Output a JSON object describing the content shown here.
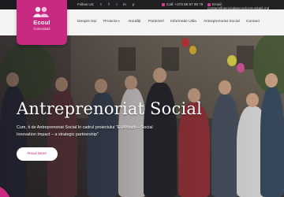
{
  "topbar": {
    "follow_label": "Follow Us:",
    "social_icons": [
      "twitter-icon",
      "facebook-icon",
      "instagram-icon",
      "linkedin-icon",
      "youtube-icon"
    ],
    "social_glyphs": [
      "t",
      "f",
      "i",
      "in",
      "y"
    ],
    "call": "Call: +373 68 57 08 79",
    "email": "Email: contact@asociatiaecoulcomunitatii.md"
  },
  "logo": {
    "line1": "Ecoul",
    "line2": "Comunitatii"
  },
  "nav": {
    "items": [
      {
        "label": "Despre Noi",
        "has_caret": false
      },
      {
        "label": "Proiecte",
        "has_caret": true
      },
      {
        "label": "Noutăți",
        "has_caret": false
      },
      {
        "label": "Parteneri",
        "has_caret": false
      },
      {
        "label": "Informatie Utila",
        "has_caret": false
      },
      {
        "label": "Antreprenoriat Social",
        "has_caret": false
      },
      {
        "label": "Contact",
        "has_caret": false
      }
    ]
  },
  "hero": {
    "title": "Antreprenoriat Social",
    "subtitle": "Cum, ti de Antreprenoriat Social în cadrul proiectului \"EU4Youth – Social Innovation Impact – a strategic partnership\"",
    "button": "Read More"
  },
  "colors": {
    "brand": "#c82a82",
    "topbar_bg": "#19191e",
    "navbar_bg": "#f4f4f4",
    "text_dark": "#3a3a3a"
  }
}
